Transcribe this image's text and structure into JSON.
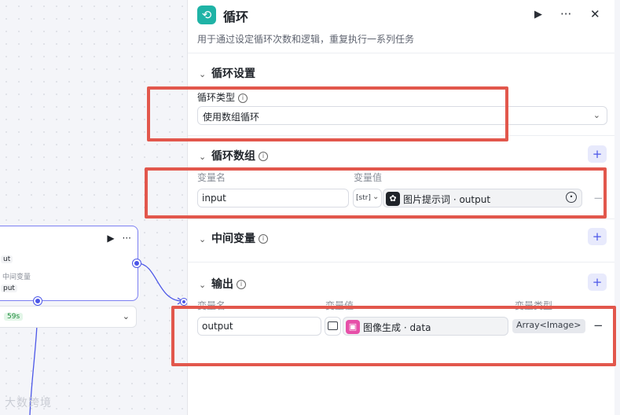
{
  "canvas": {
    "node": {
      "tag1": "ut",
      "muted_label": "中间变量",
      "tag2": "put"
    },
    "subnode": {
      "time": "59s"
    },
    "watermark": "大数跨境"
  },
  "panel": {
    "title": "循环",
    "description": "用于通过设定循环次数和逻辑，重复执行一系列任务",
    "loop_settings": {
      "title": "循环设置",
      "type_label": "循环类型",
      "type_value": "使用数组循环"
    },
    "loop_array": {
      "title": "循环数组",
      "col_name": "变量名",
      "col_value": "变量值",
      "row": {
        "name": "input",
        "type_tag": "[str]",
        "ref_text": "图片提示词 · output"
      }
    },
    "intermediate": {
      "title": "中间变量"
    },
    "output": {
      "title": "输出",
      "col_name": "变量名",
      "col_value": "变量值",
      "col_type": "变量类型",
      "row": {
        "name": "output",
        "ref_text": "图像生成 · data",
        "type_badge": "Array<Image>"
      }
    }
  },
  "colors": {
    "accent": "#4c57e8",
    "highlight": "#e2574c",
    "loop_icon": "#1fb3a6",
    "image_gen_icon": "#e64fa8"
  }
}
